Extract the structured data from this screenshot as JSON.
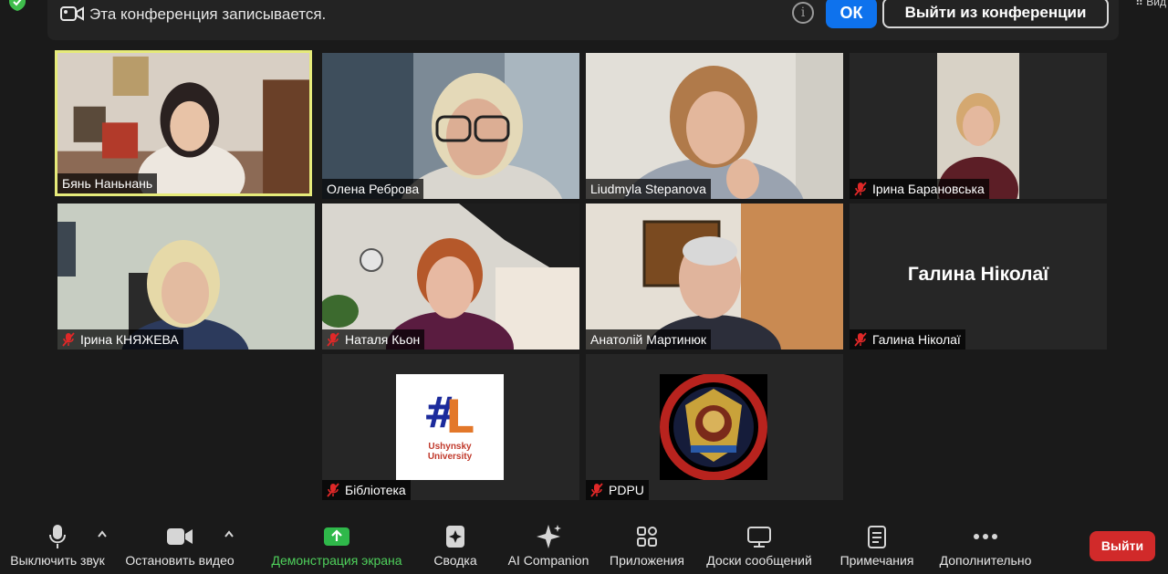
{
  "banner": {
    "text": "Эта конференция записывается.",
    "ok_label": "ОК",
    "leave_conference_label": "Выйти из конференции",
    "view_label": "Вид"
  },
  "participants": [
    {
      "name": "Бянь Наньнань",
      "muted": false,
      "active_speaker": true
    },
    {
      "name": "Олена Реброва",
      "muted": false
    },
    {
      "name": "Liudmyla Stepanova",
      "muted": false
    },
    {
      "name": "Ірина Барановська",
      "muted": true
    },
    {
      "name": "Ірина КНЯЖЕВА",
      "muted": true
    },
    {
      "name": "Наталя Кьон",
      "muted": true
    },
    {
      "name": "Анатолій Мартинюк",
      "muted": false
    },
    {
      "name": "Галина Ніколаї",
      "muted": true,
      "no_video": true
    },
    {
      "name": "Бібліотека",
      "muted": true,
      "logo_text": [
        "Ushynsky",
        "University"
      ]
    },
    {
      "name": "PDPU",
      "muted": true,
      "emblem": "university-seal"
    }
  ],
  "toolbar": {
    "mute": "Выключить звук",
    "stop_video": "Остановить видео",
    "share_screen": "Демонстрация экрана",
    "summary": "Сводка",
    "ai_companion": "AI Companion",
    "apps": "Приложения",
    "whiteboards": "Доски сообщений",
    "notes": "Примечания",
    "more": "Дополнительно",
    "leave": "Выйти"
  },
  "colors": {
    "accent_blue": "#0e72ed",
    "active_speaker_border": "#e6eb7a",
    "muted_red": "#e02828",
    "share_green": "#4fd15c",
    "leave_red": "#d12a2a"
  }
}
